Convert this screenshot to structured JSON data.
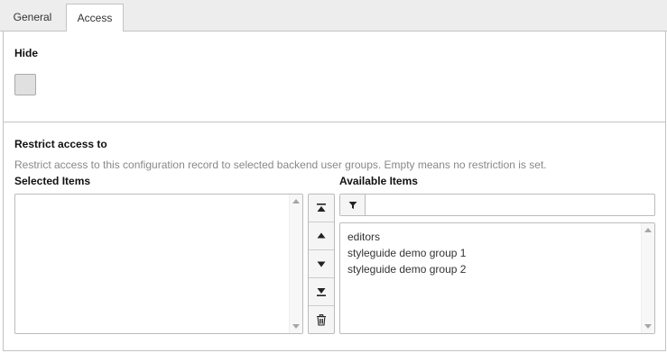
{
  "tabs": [
    {
      "label": "General",
      "active": false
    },
    {
      "label": "Access",
      "active": true
    }
  ],
  "hide": {
    "label": "Hide",
    "checked": false
  },
  "restrict": {
    "label": "Restrict access to",
    "description": "Restrict access to this configuration record to selected backend user groups. Empty means no restriction is set.",
    "selected_label": "Selected Items",
    "available_label": "Available Items",
    "selected_items": [],
    "filter": {
      "value": "",
      "placeholder": ""
    },
    "available_items": [
      "editors",
      "styleguide demo group 1",
      "styleguide demo group 2"
    ]
  },
  "icons": {
    "move_top": "move-to-top-icon",
    "move_up": "move-up-icon",
    "move_down": "move-down-icon",
    "move_bottom": "move-to-bottom-icon",
    "remove": "trash-icon",
    "filter": "filter-icon"
  }
}
